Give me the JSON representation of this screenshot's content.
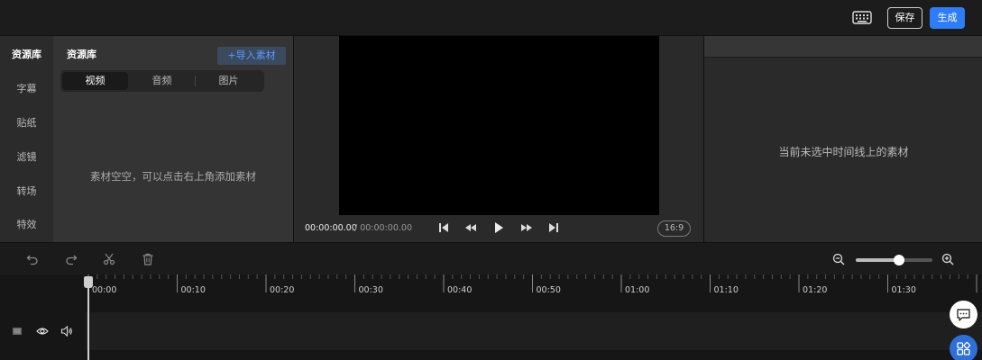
{
  "topbar": {
    "keyboard_icon": "keyboard-icon",
    "save_label": "保存",
    "generate_label": "生成",
    "accent_color": "#2f7df6"
  },
  "nav": {
    "title": "资源库",
    "items": [
      {
        "label": "字幕"
      },
      {
        "label": "贴纸"
      },
      {
        "label": "滤镜"
      },
      {
        "label": "转场"
      },
      {
        "label": "特效"
      }
    ]
  },
  "library": {
    "title": "资源库",
    "import_label": "+导入素材",
    "tabs": [
      {
        "label": "视频",
        "active": true
      },
      {
        "label": "音频",
        "active": false
      },
      {
        "label": "图片",
        "active": false
      }
    ],
    "empty_text": "素材空空，可以点击右上角添加素材"
  },
  "preview": {
    "current_time": "00:00:00.00",
    "total_time": "/ 00:00:00.00",
    "aspect_ratio": "16:9",
    "controls": [
      "skip-start-icon",
      "rewind-icon",
      "play-icon",
      "fast-forward-icon",
      "skip-end-icon"
    ]
  },
  "properties": {
    "empty_text": "当前未选中时间线上的素材"
  },
  "timeline": {
    "tools": [
      "undo-icon",
      "redo-icon",
      "cut-icon",
      "delete-icon"
    ],
    "zoom_level": 0.56,
    "ruler_labels": [
      "00:00",
      "00:10",
      "00:20",
      "00:30",
      "00:40",
      "00:50",
      "01:00",
      "01:10",
      "01:20",
      "01:30"
    ],
    "track_controls": [
      "track-thumb-icon",
      "eye-icon",
      "volume-icon"
    ]
  },
  "floating": {
    "chat_icon": "chat-icon",
    "apps_icon": "apps-icon"
  }
}
